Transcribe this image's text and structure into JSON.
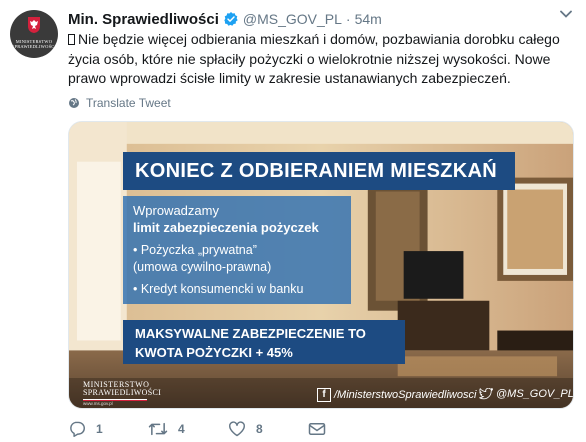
{
  "tweet": {
    "author_name": "Min. Sprawiedliwości",
    "handle": "@MS_GOV_PL",
    "separator": "·",
    "time": "54m",
    "text": "Nie będzie więcej odbierania mieszkań i domów, pozbawiania dorobku całego życia osób, które nie spłaciły pożyczki o wielokrotnie niższej wysokości. Nowe prawo wprowadzi ścisłe limity w zakresie ustanawianych zabezpieczeń.",
    "translate_label": "Translate Tweet"
  },
  "avatar": {
    "line1": "MINISTERSTWO",
    "line2": "SPRAWIEDLIWOŚCI"
  },
  "media": {
    "headline": "KONIEC Z ODBIERANIEM MIESZKAŃ",
    "intro_line1": "Wprowadzamy",
    "intro_line2": "limit zabezpieczenia pożyczek",
    "bullet1_line1": "• Pożyczka „prywatna”",
    "bullet1_line2": "  (umowa cywilno-prawna)",
    "bullet2": "• Kredyt konsumencki w banku",
    "summary_line1": "MAKSYWALNE ZABEZPIECZENIE TO",
    "summary_line2": "KWOTA POŻYCZKI + 45%",
    "logo_line1": "MINISTERSTWO",
    "logo_line2": "SPRAWIEDLIWOŚCI",
    "logo_url": "www.ms.gov.pl",
    "facebook_label": "/MinisterstwoSprawiedliwosci",
    "twitter_label": "@MS_GOV_PL"
  },
  "actions": {
    "reply_count": "1",
    "retweet_count": "4",
    "like_count": "8"
  },
  "colors": {
    "verified": "#1da1f2",
    "meta": "#657786",
    "panel_dark": "#1d4b82",
    "panel_light": "#3070b2"
  }
}
